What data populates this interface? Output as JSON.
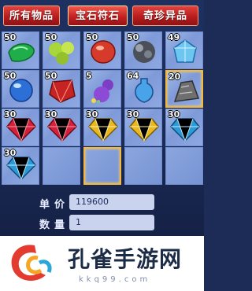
{
  "tabs": [
    {
      "label": "所有物品",
      "active": false
    },
    {
      "label": "宝石符石",
      "active": true
    },
    {
      "label": "奇珍异品",
      "active": false
    }
  ],
  "inventory": {
    "slots": [
      {
        "qty": "50",
        "icon": "green-gem-icon"
      },
      {
        "qty": "50",
        "icon": "green-orbs-icon"
      },
      {
        "qty": "50",
        "icon": "red-gem-icon"
      },
      {
        "qty": "50",
        "icon": "gray-orbs-icon"
      },
      {
        "qty": "49",
        "icon": "blue-crystal-icon"
      },
      {
        "qty": "50",
        "icon": "blue-orb-icon"
      },
      {
        "qty": "50",
        "icon": "red-crystal-icon"
      },
      {
        "qty": "5",
        "icon": "purple-gourd-icon"
      },
      {
        "qty": "64",
        "icon": "blue-vase-icon"
      },
      {
        "qty": "20",
        "icon": "gray-stone-icon",
        "selected": true
      },
      {
        "qty": "30",
        "icon": "red-diamond-icon"
      },
      {
        "qty": "30",
        "icon": "red-diamond-icon"
      },
      {
        "qty": "30",
        "icon": "yellow-diamond-icon"
      },
      {
        "qty": "30",
        "icon": "yellow-diamond-icon"
      },
      {
        "qty": "30",
        "icon": "blue-diamond-icon"
      },
      {
        "qty": "30",
        "icon": "blue-diamond-icon"
      },
      {
        "qty": "",
        "icon": ""
      },
      {
        "qty": "",
        "icon": "",
        "selected": true
      },
      {
        "qty": "",
        "icon": ""
      },
      {
        "qty": "",
        "icon": ""
      }
    ]
  },
  "price": {
    "label": "单价",
    "value": "119600"
  },
  "quantity": {
    "label": "数量",
    "value": "1"
  },
  "watermark": {
    "title": "孔雀手游网",
    "url": "kkq99.com"
  },
  "colors": {
    "tab_red": "#c52122",
    "slot_blue": "#8fa9e2",
    "panel": "#1a2a55",
    "field": "#c9d3ee"
  }
}
